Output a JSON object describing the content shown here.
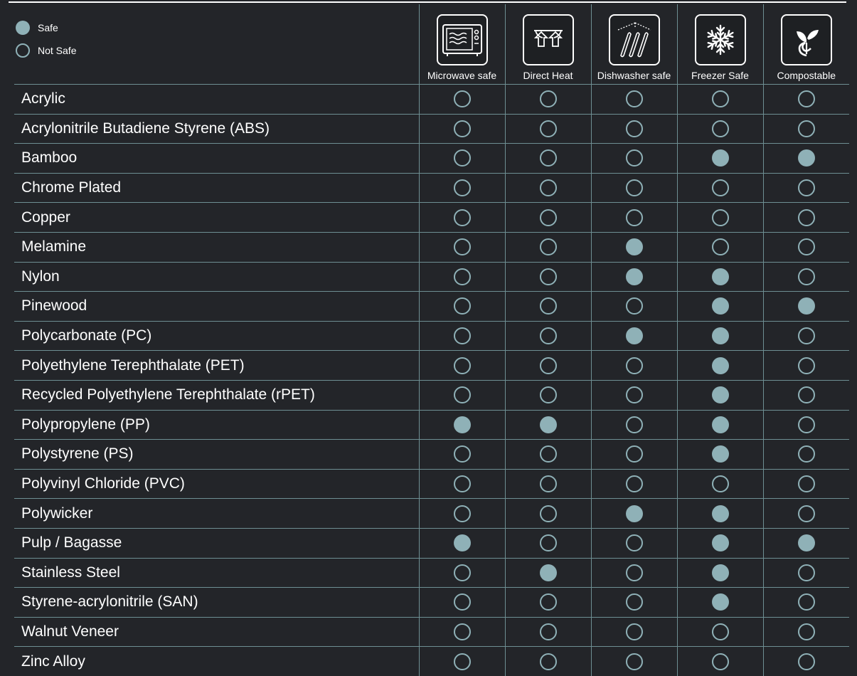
{
  "legend": {
    "safe": {
      "label": "Safe",
      "color": "#8fb1b7"
    },
    "not_safe": {
      "label": "Not Safe",
      "color": "#8fb1b7"
    }
  },
  "columns": [
    {
      "label": "Microwave safe",
      "icon": "microwave-icon"
    },
    {
      "label": "Direct Heat",
      "icon": "direct-heat-icon"
    },
    {
      "label": "Dishwasher safe",
      "icon": "dishwasher-icon"
    },
    {
      "label": "Freezer Safe",
      "icon": "snowflake-icon"
    },
    {
      "label": "Compostable",
      "icon": "sprout-icon"
    }
  ],
  "rows": [
    {
      "name": "Acrylic",
      "values": [
        false,
        false,
        false,
        false,
        false
      ]
    },
    {
      "name": "Acrylonitrile Butadiene Styrene (ABS)",
      "values": [
        false,
        false,
        false,
        false,
        false
      ]
    },
    {
      "name": "Bamboo",
      "values": [
        false,
        false,
        false,
        true,
        true
      ]
    },
    {
      "name": "Chrome Plated",
      "values": [
        false,
        false,
        false,
        false,
        false
      ]
    },
    {
      "name": "Copper",
      "values": [
        false,
        false,
        false,
        false,
        false
      ]
    },
    {
      "name": "Melamine",
      "values": [
        false,
        false,
        true,
        false,
        false
      ]
    },
    {
      "name": "Nylon",
      "values": [
        false,
        false,
        true,
        true,
        false
      ]
    },
    {
      "name": "Pinewood",
      "values": [
        false,
        false,
        false,
        true,
        true
      ]
    },
    {
      "name": "Polycarbonate (PC)",
      "values": [
        false,
        false,
        true,
        true,
        false
      ]
    },
    {
      "name": "Polyethylene Terephthalate (PET)",
      "values": [
        false,
        false,
        false,
        true,
        false
      ]
    },
    {
      "name": "Recycled Polyethylene Terephthalate (rPET)",
      "values": [
        false,
        false,
        false,
        true,
        false
      ]
    },
    {
      "name": "Polypropylene (PP)",
      "values": [
        true,
        true,
        false,
        true,
        false
      ]
    },
    {
      "name": "Polystyrene (PS)",
      "values": [
        false,
        false,
        false,
        true,
        false
      ]
    },
    {
      "name": "Polyvinyl Chloride (PVC)",
      "values": [
        false,
        false,
        false,
        false,
        false
      ]
    },
    {
      "name": "Polywicker",
      "values": [
        false,
        false,
        true,
        true,
        false
      ]
    },
    {
      "name": "Pulp / Bagasse",
      "values": [
        true,
        false,
        false,
        true,
        true
      ]
    },
    {
      "name": "Stainless Steel",
      "values": [
        false,
        true,
        false,
        true,
        false
      ]
    },
    {
      "name": "Styrene-acrylonitrile (SAN)",
      "values": [
        false,
        false,
        false,
        true,
        false
      ]
    },
    {
      "name": "Walnut Veneer",
      "values": [
        false,
        false,
        false,
        false,
        false
      ]
    },
    {
      "name": "Zinc Alloy",
      "values": [
        false,
        false,
        false,
        false,
        false
      ]
    }
  ],
  "colors": {
    "background": "#232529",
    "accent": "#8fb1b7",
    "gridline": "#6e8f93"
  }
}
